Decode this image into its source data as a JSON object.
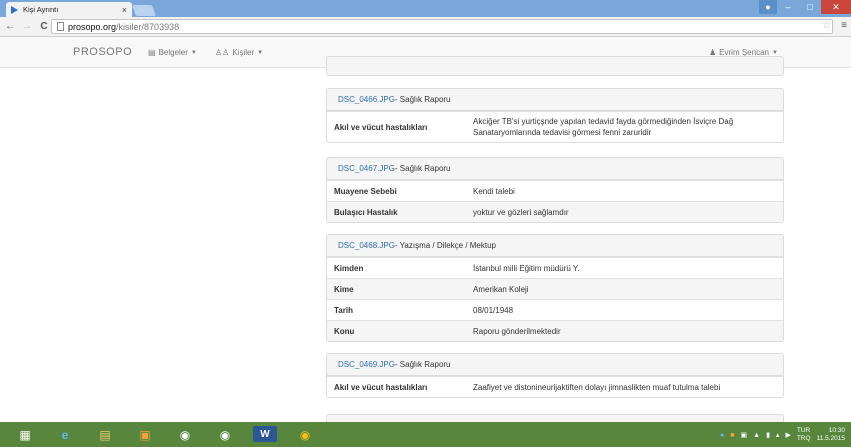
{
  "browser": {
    "tab_title": "Kişi Ayrıntı",
    "tab_close": "×",
    "url_host": "prosopo.org",
    "url_path": "/kisiler/8703938"
  },
  "navbar": {
    "brand": "PROSOPO",
    "documents": "Belgeler",
    "people": "Kişiler",
    "user": "Evrim Şencan"
  },
  "panels": [
    {
      "file": "DSC_0466.JPG",
      "type": " - Sağlık Raporu",
      "rows": [
        {
          "label": "Akıl ve vücut hastalıkları",
          "value": "Akciğer TB'si yurtiçşnde yapılan tedavid fayda görmediğinden İsviçre Dağ Sanataryomlarında tedavisi görmesi fenni zaruridir"
        }
      ]
    },
    {
      "file": "DSC_0467.JPG",
      "type": " - Sağlık Raporu",
      "rows": [
        {
          "label": "Muayene Sebebi",
          "value": "Kendi talebi"
        },
        {
          "label": "Bulaşıcı Hastalık",
          "value": "yoktur ve gözleri sağlamdır"
        }
      ]
    },
    {
      "file": "DSC_0468.JPG",
      "type": " - Yazışma / Dilekçe / Mektup",
      "rows": [
        {
          "label": "Kimden",
          "value": "İstanbul milli Eğitim müdürü Y."
        },
        {
          "label": "Kime",
          "value": "Amerikan Koleji"
        },
        {
          "label": "Tarih",
          "value": "08/01/1948"
        },
        {
          "label": "Konu",
          "value": "Raporu gönderilmektedir"
        }
      ]
    },
    {
      "file": "DSC_0469.JPG",
      "type": " - Sağlık Raporu",
      "rows": [
        {
          "label": "Akıl ve vücut hastalıkları",
          "value": "Zaafiyet ve distonineurijaktiften dolayı jimnaslikten muaf tutulma talebi"
        }
      ]
    }
  ],
  "taskbar": {
    "lang": "TUR",
    "lang2": "TRQ",
    "time": "10:30",
    "date": "11.5.2015"
  },
  "colors": {
    "link": "#2f6fab",
    "taskbar": "#57863c",
    "titlebar": "#7aa7d9"
  }
}
